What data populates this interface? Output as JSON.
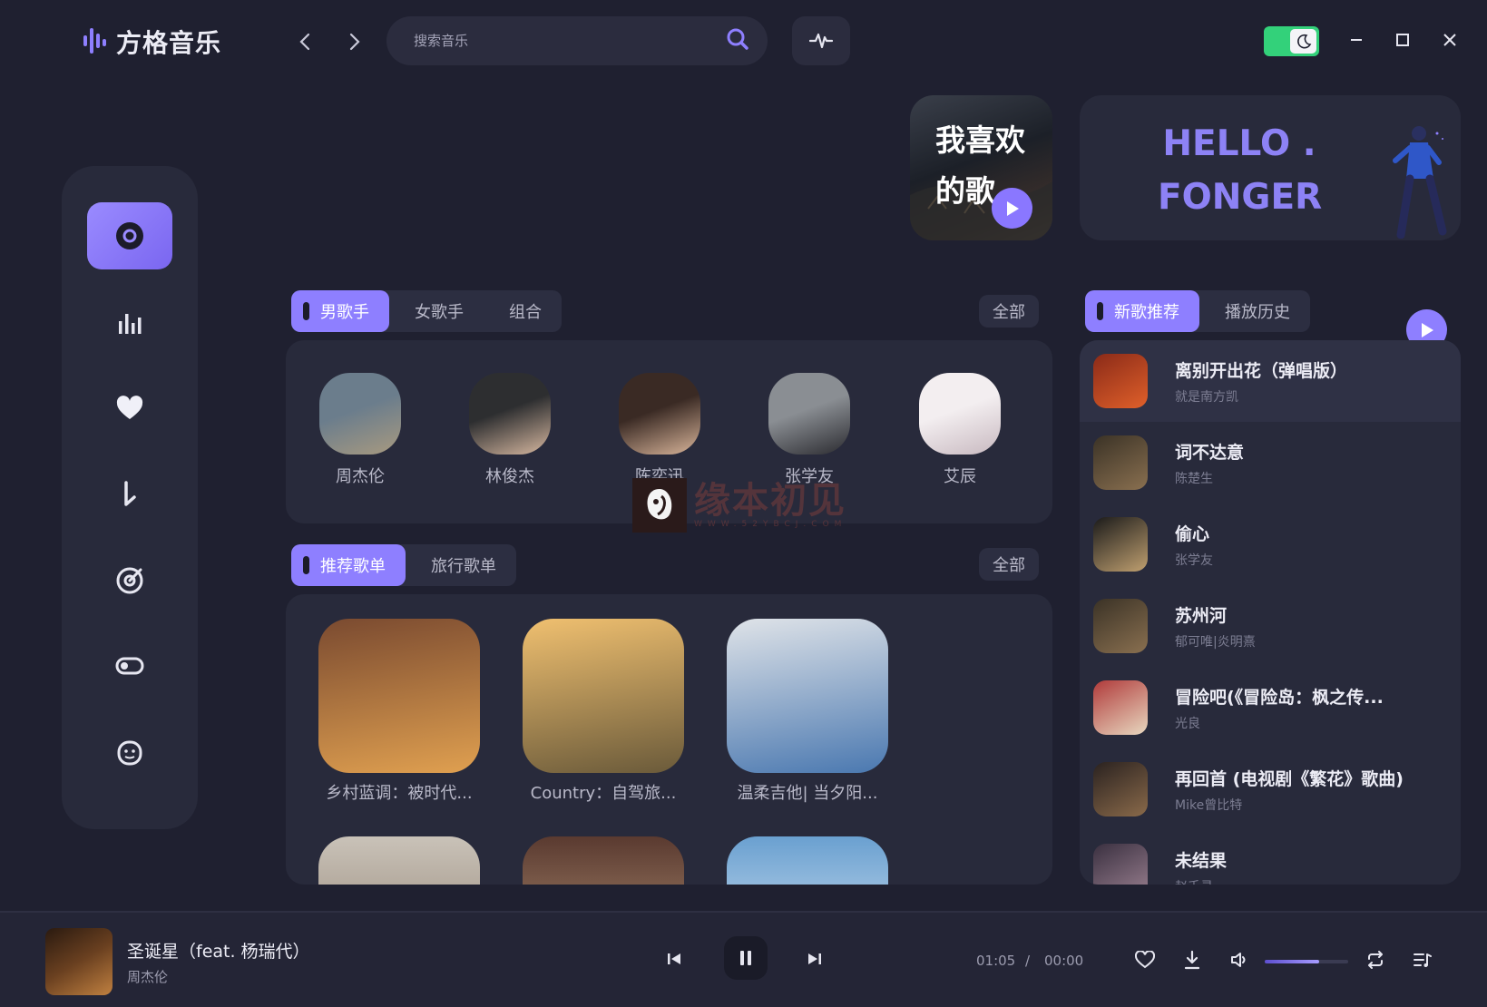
{
  "app": {
    "title": "方格音乐"
  },
  "search": {
    "placeholder": "搜索音乐"
  },
  "favorite_card": {
    "title": "我喜欢的歌"
  },
  "hello_card": {
    "line1": "HELLO .",
    "line2": "FONGER"
  },
  "sidebar": {
    "items": [
      {
        "icon": "disc-icon",
        "active": true
      },
      {
        "icon": "chart-bars-icon",
        "active": false
      },
      {
        "icon": "heart-icon",
        "active": false
      },
      {
        "icon": "download-icon",
        "active": false
      },
      {
        "icon": "radar-icon",
        "active": false
      },
      {
        "icon": "toggle-icon",
        "active": false
      },
      {
        "icon": "face-icon",
        "active": false
      }
    ]
  },
  "artists_section": {
    "tabs": [
      "男歌手",
      "女歌手",
      "组合"
    ],
    "active_tab": 0,
    "all_label": "全部",
    "artists": [
      {
        "name": "周杰伦",
        "colors": [
          "#6b7d8c",
          "#a89a80"
        ]
      },
      {
        "name": "林俊杰",
        "colors": [
          "#2d2e30",
          "#d7b8a0"
        ]
      },
      {
        "name": "陈奕迅",
        "colors": [
          "#3a2a24",
          "#d9b59a"
        ]
      },
      {
        "name": "张学友",
        "colors": [
          "#8a8e93",
          "#2b2b30"
        ]
      },
      {
        "name": "艾辰",
        "colors": [
          "#f3eef0",
          "#c8b9c0"
        ]
      }
    ]
  },
  "playlists_section": {
    "tabs": [
      "推荐歌单",
      "旅行歌单"
    ],
    "active_tab": 0,
    "all_label": "全部",
    "playlists": [
      {
        "title": "乡村蓝调：被时代...",
        "colors": [
          "#7a4a30",
          "#e0a050"
        ]
      },
      {
        "title": "Country：自驾旅...",
        "colors": [
          "#f0c070",
          "#6a5a3a"
        ]
      },
      {
        "title": "温柔吉他| 当夕阳...",
        "colors": [
          "#dfe3e8",
          "#4a78b0"
        ]
      }
    ]
  },
  "songs_section": {
    "tabs": [
      "新歌推荐",
      "播放历史"
    ],
    "active_tab": 0,
    "songs": [
      {
        "title": "离别开出花（弹唱版）",
        "artist": "就是南方凯",
        "colors": [
          "#8a2a18",
          "#e0602a"
        ]
      },
      {
        "title": "词不达意",
        "artist": "陈楚生",
        "colors": [
          "#3a3226",
          "#8a7050"
        ]
      },
      {
        "title": "偷心",
        "artist": "张学友",
        "colors": [
          "#1a1a1a",
          "#c0a070"
        ]
      },
      {
        "title": "苏州河",
        "artist": "郁可唯|炎明熹",
        "colors": [
          "#3a3226",
          "#8a7050"
        ]
      },
      {
        "title": "冒险吧(《冒险岛：枫之传...",
        "artist": "光良",
        "colors": [
          "#b03a3a",
          "#e8d8c0"
        ]
      },
      {
        "title": "再回首 (电视剧《繁花》歌曲)",
        "artist": "Mike曾比特",
        "colors": [
          "#2a2220",
          "#8a6a4a"
        ]
      },
      {
        "title": "未结果",
        "artist": "赵千寻",
        "colors": [
          "#3a3040",
          "#9a8090"
        ]
      }
    ]
  },
  "player": {
    "title": "圣诞星（feat. 杨瑞代）",
    "artist": "周杰伦",
    "current_time": "01:05",
    "separator": "/",
    "total_time": "00:00",
    "volume": 0.65
  },
  "watermark": {
    "main": "缘本初见",
    "sub": "WWW.52YBCJ.COM"
  },
  "colors": {
    "accent": "#8e7fff",
    "background": "#1f2030",
    "panel": "#282a3b",
    "toggle_on": "#33d17a"
  }
}
